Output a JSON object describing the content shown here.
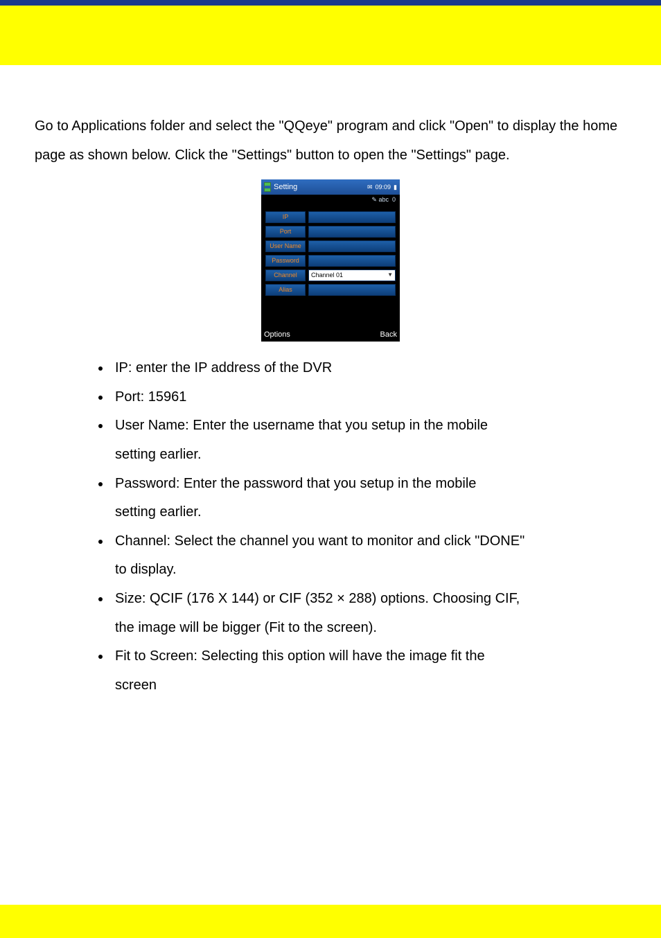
{
  "para1": {
    "t1": "Go to",
    "t2": "Applications folder and select the \"",
    "t3": "QQeye",
    "t4": "\" program",
    "t5": " and click \"",
    "t6": "Open",
    "t7": "\" to display",
    "t8": "the home page as shown below. Click",
    "t9": " the \"",
    "t10": "Settings",
    "t11": "\" button to open the \"",
    "t12": "Settings",
    "t13": "\"",
    "t14": "page."
  },
  "phone": {
    "title": "Setting",
    "time": "09:09",
    "sub": "abc",
    "subnum": "0",
    "labels": {
      "ip": "IP",
      "port": "Port",
      "user": "User Name",
      "pass": "Password",
      "channel": "Channel",
      "alias": "Alias"
    },
    "channel_value": "Channel 01",
    "options": "Options",
    "back": "Back"
  },
  "items": {
    "i1": "IP: enter the IP address of the DVR",
    "i2": "Port: 15961",
    "i3a": "User Name: Enter the username that you setup in the mobile",
    "i3b": "setting earlier.",
    "i4a": "Password: Enter the password that you setup in the mobile",
    "i4b": "setting earlier.",
    "i5a": "Channel: Select the channel you want to monitor and click \"DONE\"",
    "i5b": "to display.",
    "i6a": "Size: QCIF (176 X 144) or CIF (352 × 288) options. Choosing CIF,",
    "i6b": "the image will be bigger (Fit to the screen).",
    "i7a": "Fit to Screen: Selecting this option will have the image fit the",
    "i7b": "screen"
  }
}
